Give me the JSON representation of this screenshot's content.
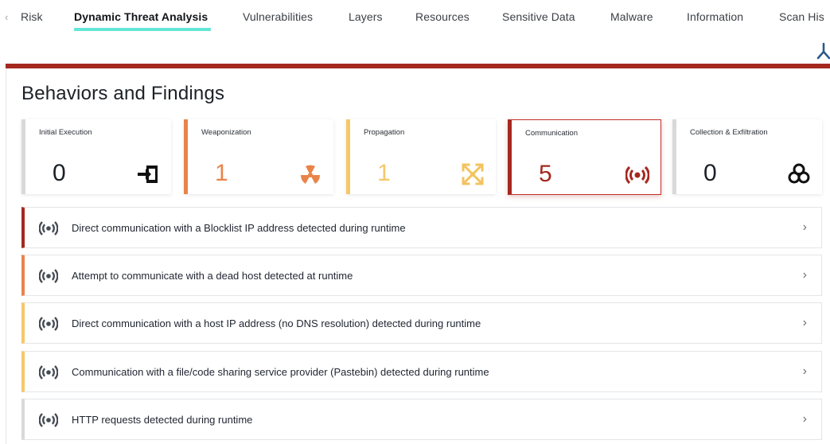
{
  "tabs": [
    {
      "label": "Risk",
      "active": false
    },
    {
      "label": "Dynamic Threat Analysis",
      "active": true
    },
    {
      "label": "Vulnerabilities",
      "active": false
    },
    {
      "label": "Layers",
      "active": false
    },
    {
      "label": "Resources",
      "active": false
    },
    {
      "label": "Sensitive Data",
      "active": false
    },
    {
      "label": "Malware",
      "active": false
    },
    {
      "label": "Information",
      "active": false
    },
    {
      "label": "Scan His",
      "active": false
    }
  ],
  "colors": {
    "accent_tab": "#63e6d6",
    "panel_bar": "#a5281f",
    "stage_initial": "#d9d9d9",
    "stage_weaponization": "#e8844a",
    "stage_propagation": "#f5c86a",
    "stage_communication": "#a5281f",
    "stage_collection": "#d9d9d9"
  },
  "section": {
    "title": "Behaviors and Findings"
  },
  "stages": [
    {
      "label": "Initial Execution",
      "count": "0",
      "icon": "execute-icon",
      "color": "#d9d9d9",
      "num_color": "#1b2127"
    },
    {
      "label": "Weaponization",
      "count": "1",
      "icon": "radiation-icon",
      "color": "#e8844a",
      "num_color": "#e8844a"
    },
    {
      "label": "Propagation",
      "count": "1",
      "icon": "spread-icon",
      "color": "#f5c86a",
      "num_color": "#f5c86a"
    },
    {
      "label": "Communication",
      "count": "5",
      "icon": "broadcast-icon",
      "color": "#a5281f",
      "num_color": "#a5281f"
    },
    {
      "label": "Collection & Exfiltration",
      "count": "0",
      "icon": "biohazard-icon",
      "color": "#d9d9d9",
      "num_color": "#1b2127"
    }
  ],
  "findings": [
    {
      "text": "Direct communication with a Blocklist IP address detected during runtime",
      "severity_color": "#a5281f"
    },
    {
      "text": "Attempt to communicate with a dead host detected at runtime",
      "severity_color": "#e8844a"
    },
    {
      "text": "Direct communication with a host IP address (no DNS resolution) detected during runtime",
      "severity_color": "#f5c86a"
    },
    {
      "text": "Communication with a file/code sharing service provider (Pastebin) detected during runtime",
      "severity_color": "#f5c86a"
    },
    {
      "text": "HTTP requests detected during runtime",
      "severity_color": "#d9d9d9"
    }
  ]
}
